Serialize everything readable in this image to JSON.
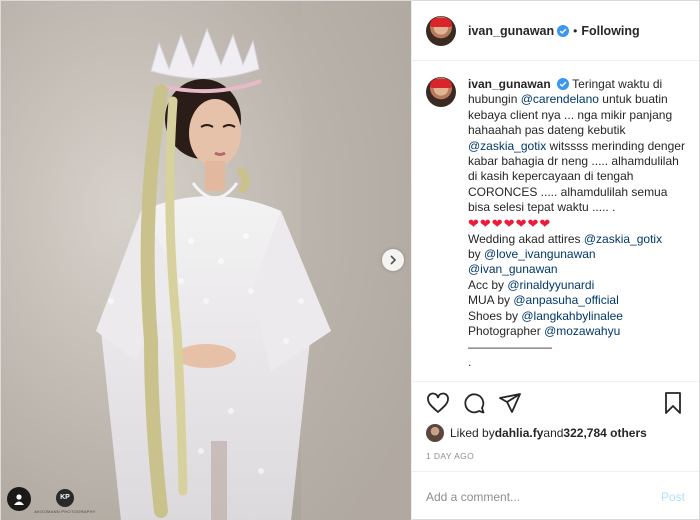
{
  "header": {
    "username": "ivan_gunawan",
    "separator": "•",
    "follow_label": "Following"
  },
  "caption": {
    "username": "ivan_gunawan",
    "lines": {
      "p1a": " Teringat waktu di hubungin ",
      "m1": "@carendelano",
      "p1b": " untuk buatin kebaya client nya ... nga mikir panjang hahaahah pas dateng kebutik ",
      "m2": "@zaskia_gotix",
      "p1c": " witssss merinding denger kabar bahagia dr neng ..... alhamdulilah di kasih kepercayaan di tengah CORONCES ..... alhamdulilah semua bisa selesi tepat waktu ..... ."
    },
    "hearts": "❤❤❤❤❤❤❤",
    "credits": {
      "attires_label": "Wedding akad attires ",
      "attires_mention": "@zaskia_gotix",
      "by_label": "by ",
      "by_mention1": "@love_ivangunawan",
      "by_mention2": "@ivan_gunawan",
      "acc_label": "Acc by ",
      "acc_mention": "@rinaldyyunardi",
      "mua_label": "MUA by ",
      "mua_mention": "@anpasuha_official",
      "shoes_label": "Shoes by ",
      "shoes_mention": "@langkahbylinalee",
      "photo_label": "Photographer ",
      "photo_mention": "@mozawahyu",
      "rule": "———————",
      "end": "."
    }
  },
  "actions": {
    "icons": [
      "heart-icon",
      "comment-icon",
      "share-icon",
      "bookmark-icon"
    ]
  },
  "likes": {
    "prefix": "Liked by ",
    "user": "dahlia.fy",
    "and": " and ",
    "count": "322,784 others"
  },
  "timestamp": "1 DAY AGO",
  "add_comment": {
    "placeholder": "Add a comment...",
    "post_label": "Post"
  },
  "watermark": {
    "logo": "KP",
    "text": "AKOOMANN PHOTOGRAPHY"
  },
  "colors": {
    "mention": "#00376b",
    "heart": "#ed1b3a",
    "verified": "#3897f0",
    "post_disabled": "#b2dffc"
  }
}
